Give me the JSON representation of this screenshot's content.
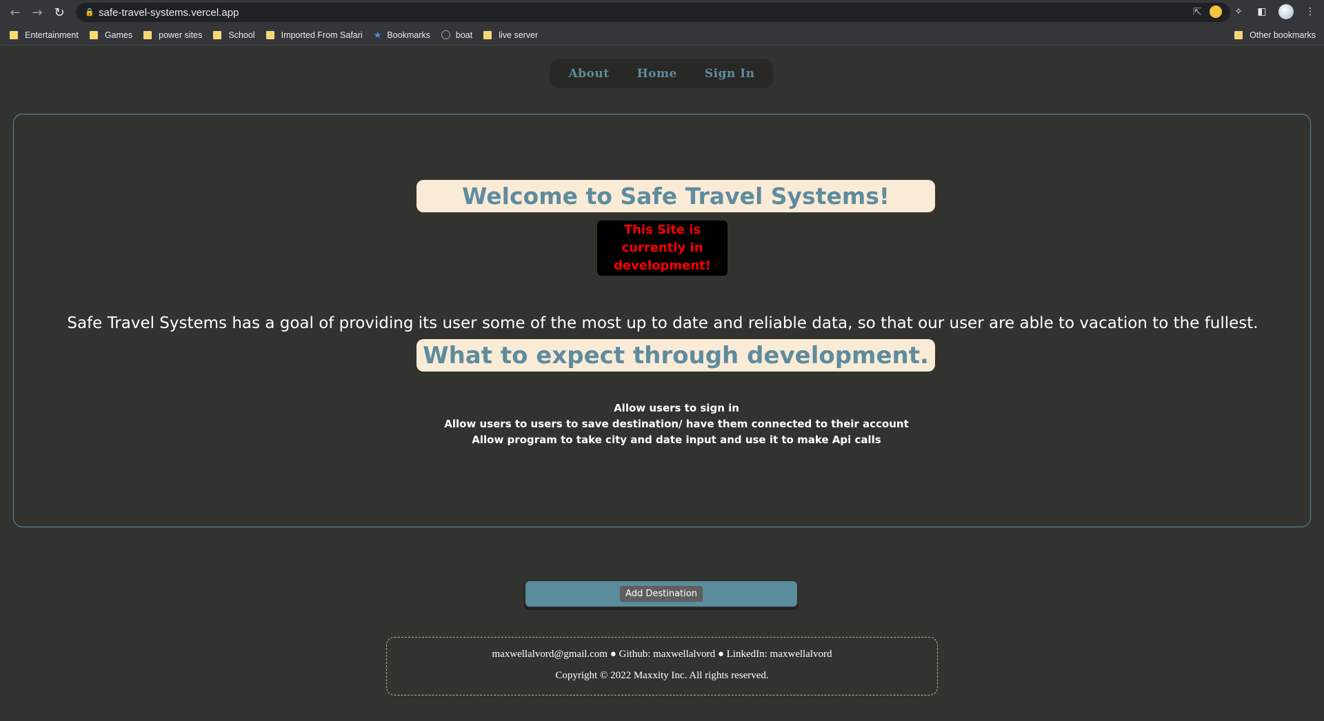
{
  "browser": {
    "url": "safe-travel-systems.vercel.app",
    "bookmarks": [
      {
        "label": "Entertainment",
        "icon": "folder-icon"
      },
      {
        "label": "Games",
        "icon": "folder-icon"
      },
      {
        "label": "power sites",
        "icon": "folder-icon"
      },
      {
        "label": "School",
        "icon": "folder-icon"
      },
      {
        "label": "Imported From Safari",
        "icon": "folder-icon"
      },
      {
        "label": "Bookmarks",
        "icon": "star-icon"
      },
      {
        "label": "boat",
        "icon": "globe-icon"
      },
      {
        "label": "live server",
        "icon": "folder-icon"
      }
    ],
    "other_bookmarks": "Other bookmarks"
  },
  "nav": {
    "about": "About",
    "home": "Home",
    "sign_in": "Sign In"
  },
  "main": {
    "welcome_title": "Welcome to Safe Travel Systems!",
    "dev_badge_line1": "This Site is",
    "dev_badge_line2": "currently in",
    "dev_badge_line3": "development!",
    "goal_text": "Safe Travel Systems has a goal of providing its user some of the most up to date and reliable data, so that our user are able to vacation to the fullest.",
    "expect_title": "What to expect through development.",
    "expect_items": [
      "Allow users to sign in",
      "Allow users to users to save destination/ have them connected to their account",
      "Allow program to take city and date input and use it to make Api calls"
    ]
  },
  "actions": {
    "add_destination": "Add Destination"
  },
  "footer": {
    "contact": "maxwellalvord@gmail.com ● Github: maxwellalvord ● LinkedIn: maxwellalvord",
    "copyright": "Copyright © 2022 Maxxity Inc. All rights reserved."
  },
  "colors": {
    "page_bg": "#32332f",
    "accent": "#5e8c9e",
    "pill_bg": "#faebd7",
    "dev_text": "#ff0000"
  }
}
